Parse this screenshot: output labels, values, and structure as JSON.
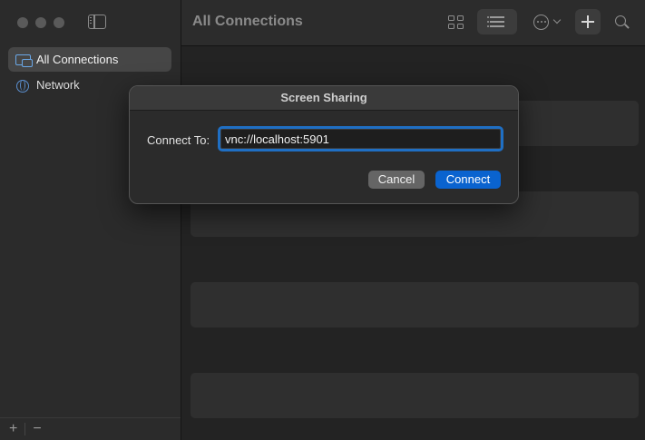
{
  "sidebar": {
    "items": [
      {
        "label": "All Connections",
        "icon": "monitor-icon",
        "selected": true
      },
      {
        "label": "Network",
        "icon": "globe-icon",
        "selected": false
      }
    ],
    "footer": {
      "add": "+",
      "remove": "−"
    }
  },
  "toolbar": {
    "title": "All Connections"
  },
  "dialog": {
    "title": "Screen Sharing",
    "label": "Connect To:",
    "input_value": "vnc://localhost:5901",
    "cancel_label": "Cancel",
    "connect_label": "Connect"
  },
  "colors": {
    "accent": "#0a63cf",
    "focus_ring": "#1f6fc4"
  }
}
